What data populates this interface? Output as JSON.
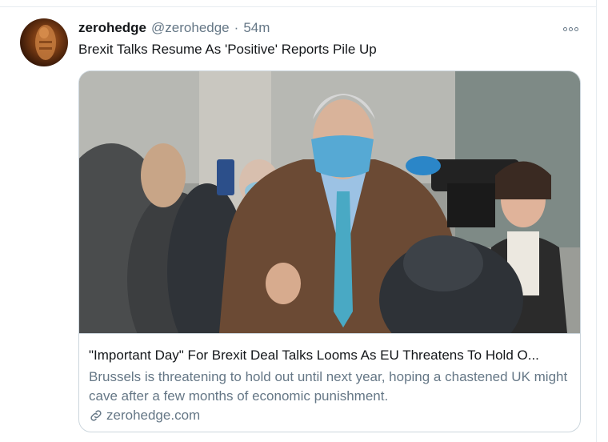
{
  "tweet": {
    "author_name": "zerohedge",
    "author_handle": "@zerohedge",
    "separator": "·",
    "timestamp": "54m",
    "text": "Brexit Talks Resume As 'Positive' Reports Pile Up",
    "more_icon": "more-horizontal-icon"
  },
  "card": {
    "title": "\"Important Day\" For Brexit Deal Talks Looms As EU Threatens To Hold O...",
    "description": "Brussels is threatening to hold out until next year, hoping a chastened UK might cave after a few months of economic punishment.",
    "domain": "zerohedge.com",
    "link_icon": "link-icon"
  },
  "colors": {
    "text_primary": "#14171a",
    "text_secondary": "#657786",
    "border": "#ccd6dd"
  }
}
